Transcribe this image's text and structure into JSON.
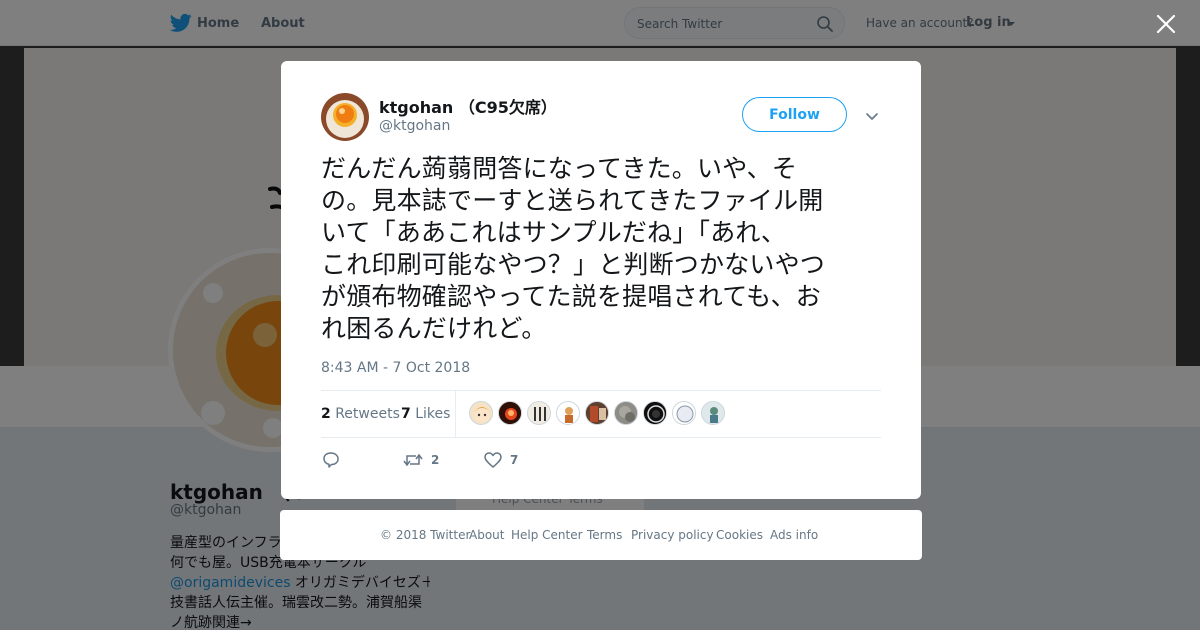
{
  "colors": {
    "brand": "#1da1f2",
    "link": "#1b95e0",
    "muted": "#657786",
    "text": "#14171a"
  },
  "nav": {
    "logo_icon": "twitter-bird-icon",
    "home_label": "Home",
    "about_label": "About",
    "search_placeholder": "Search Twitter",
    "have_account": "Have an account?",
    "login_label": "Log in"
  },
  "background_profile": {
    "name": "ktgohan （C",
    "handle": "@ktgohan",
    "bio_lines": [
      {
        "text": "量産型のインフラ"
      },
      {
        "text": "何でも屋。USB充電本サークル"
      },
      {
        "link": "@origamidevices",
        "text": " オリガミデバイセズ＋"
      },
      {
        "text": "技書話人伝主催。瑞雲改二勢。浦賀船渠"
      },
      {
        "text": "ノ航跡関連→"
      }
    ],
    "footer_links": "Help Center   Terms"
  },
  "tweet": {
    "display_name": "ktgohan （C95欠席）",
    "handle": "@ktgohan",
    "follow_label": "Follow",
    "text_lines": [
      "だんだん蒟蒻問答になってきた。いや、そ",
      "の。見本誌でーすと送られてきたファイル開",
      "いて「ああこれはサンプルだね」「あれ、",
      "これ印刷可能なやつ？」と判断つかないやつ",
      "が頒布物確認やってた説を提唱されても、お",
      "れ困るんだけれど。"
    ],
    "timestamp": "8:43 AM - 7 Oct 2018",
    "retweets_count": "2",
    "retweets_label": "Retweets",
    "likes_count": "7",
    "likes_label": "Likes",
    "likers": [
      "anime-avatar",
      "flame-avatar",
      "kanji-avatar",
      "character-avatar",
      "photo-avatar",
      "grey-avatar",
      "dark-avatar",
      "white-avatar",
      "figure-avatar"
    ],
    "actions": {
      "reply_count": "",
      "retweet_count": "2",
      "like_count": "7"
    }
  },
  "footer": {
    "copyright": "© 2018 Twitter",
    "about": "About",
    "help_center": "Help Center",
    "terms": "Terms",
    "privacy": "Privacy policy",
    "cookies": "Cookies",
    "ads_info": "Ads info"
  }
}
